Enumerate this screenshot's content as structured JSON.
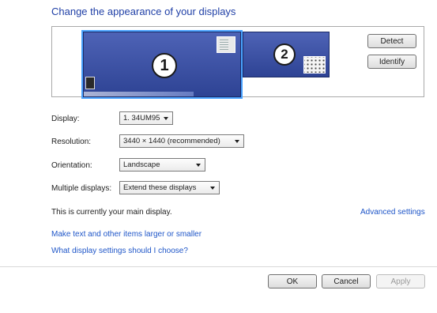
{
  "header": {
    "title": "Change the appearance of your displays"
  },
  "preview": {
    "monitors": [
      {
        "number": "1",
        "selected": true
      },
      {
        "number": "2",
        "selected": false
      }
    ]
  },
  "buttons": {
    "detect": "Detect",
    "identify": "Identify",
    "ok": "OK",
    "cancel": "Cancel",
    "apply": "Apply"
  },
  "settings": {
    "display": {
      "label": "Display:",
      "value": "1. 34UM95"
    },
    "resolution": {
      "label": "Resolution:",
      "value": "3440 × 1440 (recommended)"
    },
    "orientation": {
      "label": "Orientation:",
      "value": "Landscape"
    },
    "multiple": {
      "label": "Multiple displays:",
      "value": "Extend these displays"
    }
  },
  "status_text": "This is currently your main display.",
  "links": {
    "advanced": "Advanced settings",
    "text_size": "Make text and other items larger or smaller",
    "help": "What display settings should I choose?"
  },
  "colors": {
    "title": "#1f3fa6",
    "link": "#1f56c8",
    "monitor": "#3d51a5",
    "selection": "#4aa3ff"
  }
}
